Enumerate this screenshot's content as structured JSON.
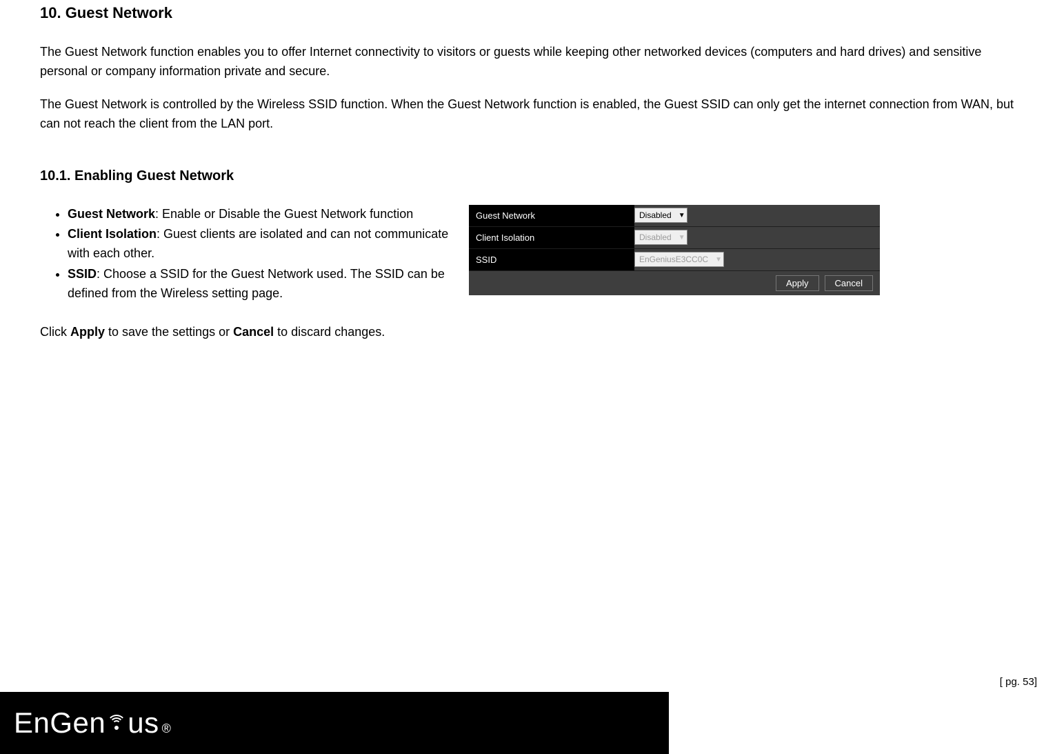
{
  "headings": {
    "section": "10. Guest Network",
    "subsection": "10.1.  Enabling Guest Network"
  },
  "paragraphs": {
    "intro1": "The Guest Network function enables you to offer Internet connectivity to visitors or guests while keeping other networked devices (computers and hard drives) and sensitive personal or company information private and secure.",
    "intro2": "The Guest Network is controlled by the Wireless SSID function. When the Guest Network function is enabled, the Guest SSID can only get the internet connection from WAN, but can not reach the client from the LAN port."
  },
  "bullets": [
    {
      "term": "Guest Network",
      "desc": ": Enable or Disable the Guest Network function"
    },
    {
      "term": "Client Isolation",
      "desc": ": Guest clients are isolated and can not communicate with each other."
    },
    {
      "term": "SSID",
      "desc": ": Choose a SSID for the Guest Network used. The SSID can be defined from the Wireless setting page."
    }
  ],
  "apply_sentence": {
    "pre": "Click ",
    "apply": "Apply",
    "mid": " to save the settings or ",
    "cancel": "Cancel",
    "post": " to discard changes."
  },
  "panel": {
    "rows": [
      {
        "label": "Guest Network",
        "value": "Disabled",
        "enabled": true
      },
      {
        "label": "Client Isolation",
        "value": "Disabled",
        "enabled": false
      },
      {
        "label": "SSID",
        "value": "EnGeniusE3CC0C",
        "enabled": false
      }
    ],
    "buttons": {
      "apply": "Apply",
      "cancel": "Cancel"
    }
  },
  "footer": {
    "logo_pre": "EnGen",
    "logo_post": "us",
    "reg": "®",
    "page_number": "[ pg. 53]"
  }
}
